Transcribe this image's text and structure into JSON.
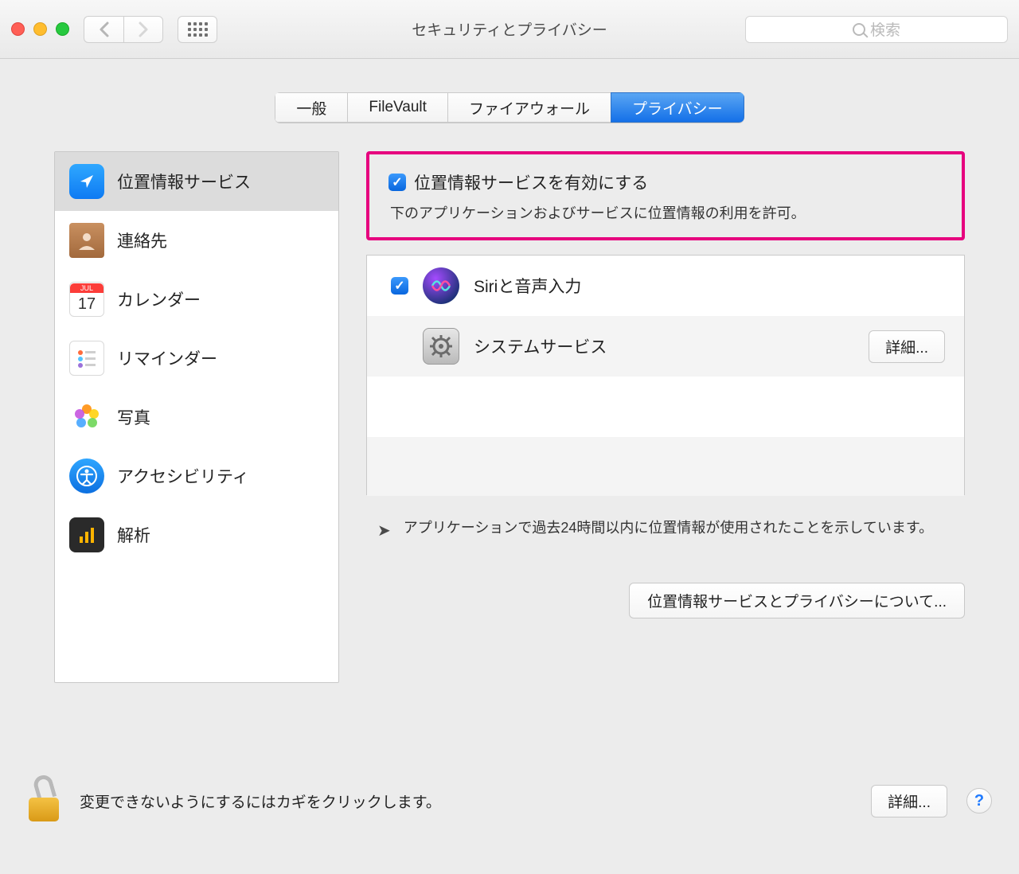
{
  "window": {
    "title": "セキュリティとプライバシー",
    "search_placeholder": "検索"
  },
  "tabs": [
    {
      "label": "一般"
    },
    {
      "label": "FileVault"
    },
    {
      "label": "ファイアウォール"
    },
    {
      "label": "プライバシー",
      "active": true
    }
  ],
  "sidebar": {
    "items": [
      {
        "label": "位置情報サービス",
        "icon": "location-icon",
        "selected": true
      },
      {
        "label": "連絡先",
        "icon": "contacts-icon"
      },
      {
        "label": "カレンダー",
        "icon": "calendar-icon",
        "badge_num": "17",
        "badge_month": "JUL"
      },
      {
        "label": "リマインダー",
        "icon": "reminders-icon"
      },
      {
        "label": "写真",
        "icon": "photos-icon"
      },
      {
        "label": "アクセシビリティ",
        "icon": "accessibility-icon"
      },
      {
        "label": "解析",
        "icon": "analytics-icon"
      }
    ]
  },
  "main": {
    "enable_checkbox_label": "位置情報サービスを有効にする",
    "enable_description": "下のアプリケーションおよびサービスに位置情報の利用を許可。",
    "apps": [
      {
        "label": "Siriと音声入力",
        "checked": true,
        "icon": "siri"
      },
      {
        "label": "システムサービス",
        "icon": "system",
        "details_label": "詳細..."
      }
    ],
    "legend_text": "アプリケーションで過去24時間以内に位置情報が使用されたことを示しています。",
    "about_button": "位置情報サービスとプライバシーについて..."
  },
  "footer": {
    "lock_text": "変更できないようにするにはカギをクリックします。",
    "advanced_button": "詳細..."
  }
}
